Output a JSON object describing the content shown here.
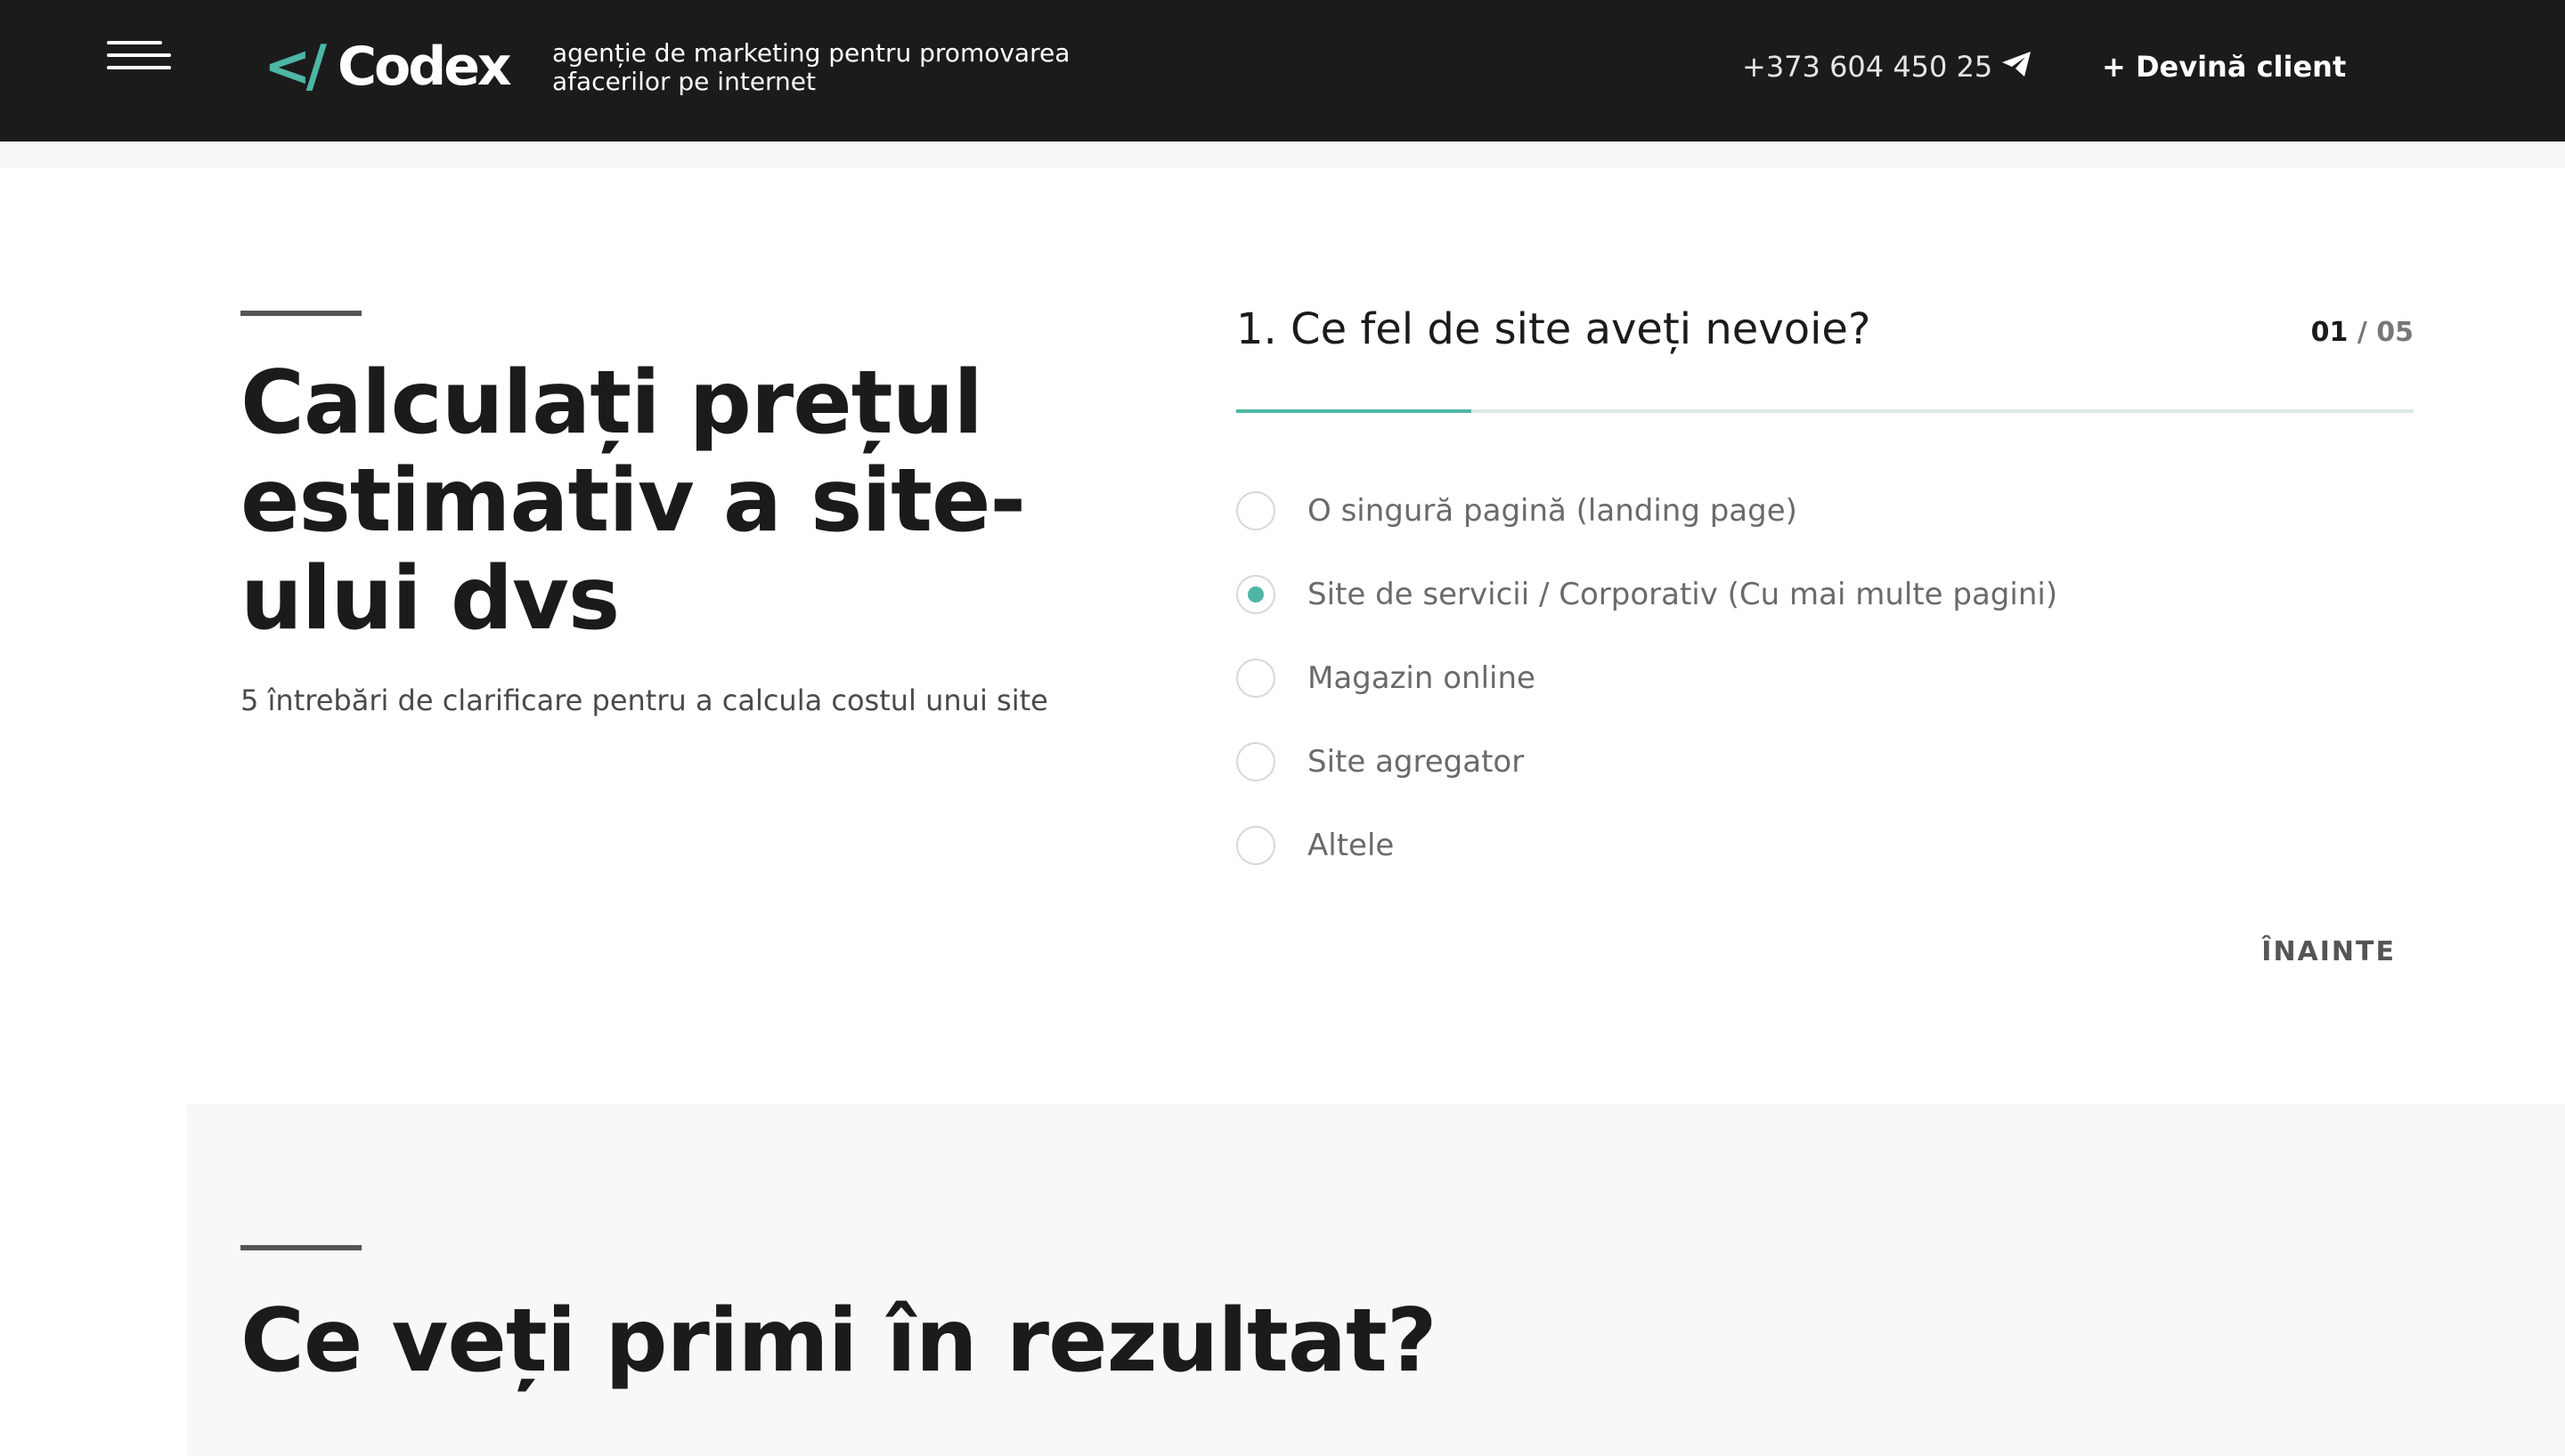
{
  "header": {
    "logo_mark": "</",
    "logo_text": "Codex",
    "tagline": "agenție de marketing pentru promovarea afacerilor pe internet",
    "phone": "+373 604 450 25",
    "cta_label": "+ Devină client"
  },
  "calculator": {
    "title": "Calculați prețul estimativ a site-ului dvs",
    "subtitle": "5 întrebări de clarificare pentru a calcula costul unui site"
  },
  "quiz": {
    "question": "1. Ce fel de site aveți nevoie?",
    "step_current": "01",
    "step_sep": " / ",
    "step_total": "05",
    "progress_fraction": 0.2,
    "options": [
      {
        "label": "O singură pagină (landing page)",
        "selected": false
      },
      {
        "label": "Site de servicii / Corporativ (Cu mai multe pagini)",
        "selected": true
      },
      {
        "label": "Magazin online",
        "selected": false
      },
      {
        "label": "Site agregator",
        "selected": false
      },
      {
        "label": "Altele",
        "selected": false
      }
    ],
    "next_label": "ÎNAINTE"
  },
  "result_section": {
    "title": "Ce veți primi în rezultat?"
  },
  "colors": {
    "accent": "#4db6a4",
    "header_bg": "#1b1b1b",
    "section_bg": "#f8f8f8"
  }
}
